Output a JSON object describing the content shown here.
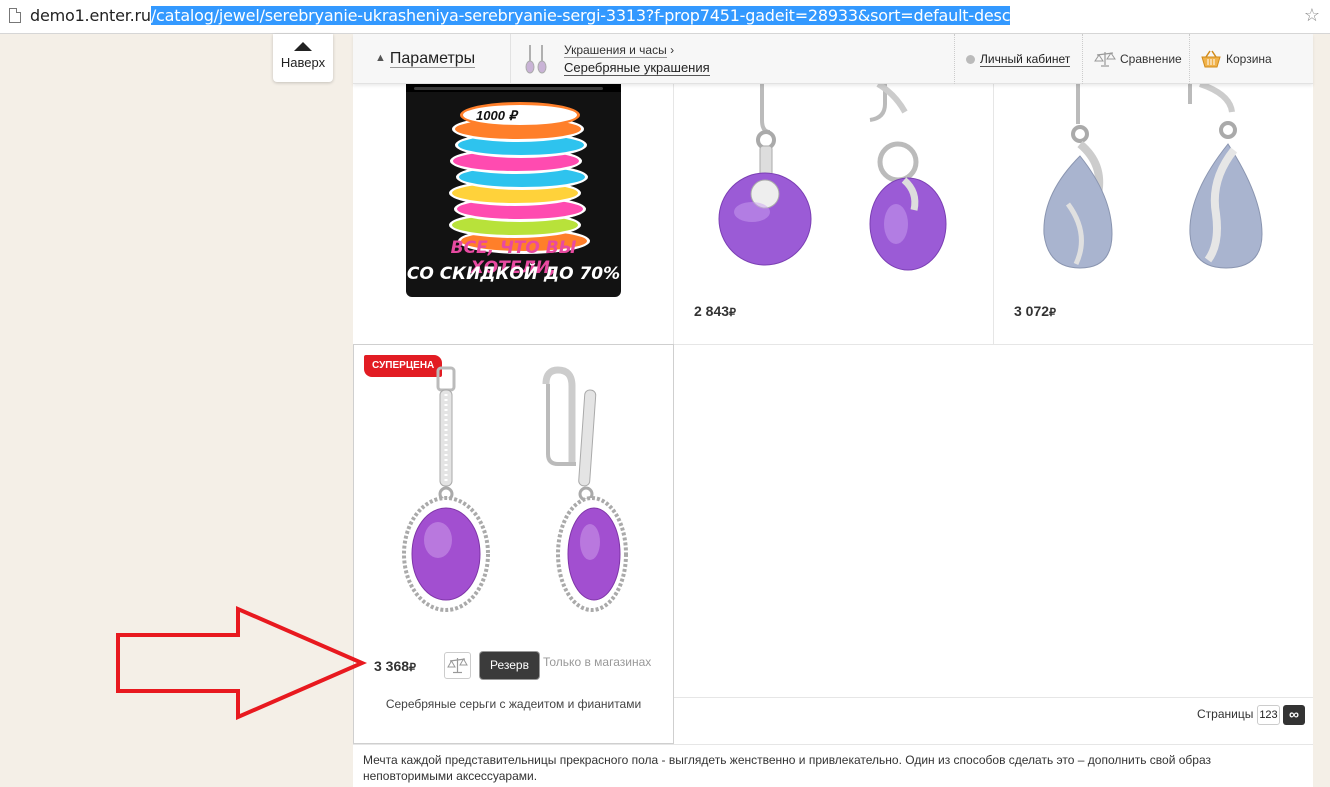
{
  "browser": {
    "url_host": "demo1.enter.ru",
    "url_path": "/catalog/jewel/serebryanie-ukrasheniya-serebryanie-sergi-3313?f-prop7451-gadeit=28933&sort=default-desc"
  },
  "to_top": {
    "label": "Наверх"
  },
  "header": {
    "params_label": "Параметры",
    "breadcrumb_parent": "Украшения и часы",
    "breadcrumb_sep": "›",
    "breadcrumb_current": "Серебряные украшения",
    "cabinet_label": "Личный кабинет",
    "compare_label": "Сравнение",
    "cart_label": "Корзина"
  },
  "banner": {
    "chip_amount": "1000 ₽",
    "line1": "ВСЕ, ЧТО ВЫ ХОТЕЛИ,",
    "line2": "СО СКИДКОЙ ДО 70%"
  },
  "products": [
    {
      "price": "2 843",
      "currency": "₽",
      "stone_color": "#9b5bd6"
    },
    {
      "price": "3 072",
      "currency": "₽",
      "stone_color": "#a9b4cf"
    },
    {
      "badge": "СУПЕРЦЕНА",
      "price": "3 368",
      "currency": "₽",
      "reserve_label": "Резерв",
      "availability": "Только в магазинах",
      "name": "Серебряные серьги с жадеитом и фианитами",
      "stone_color": "#a24fd0"
    }
  ],
  "pagination": {
    "label": "Страницы",
    "pages": "123",
    "all_symbol": "∞"
  },
  "description": "Мечта каждой представительницы прекрасного пола - выглядеть женственно и привлекательно. Один из способов сделать это – дополнить свой образ неповторимыми аксессуарами."
}
